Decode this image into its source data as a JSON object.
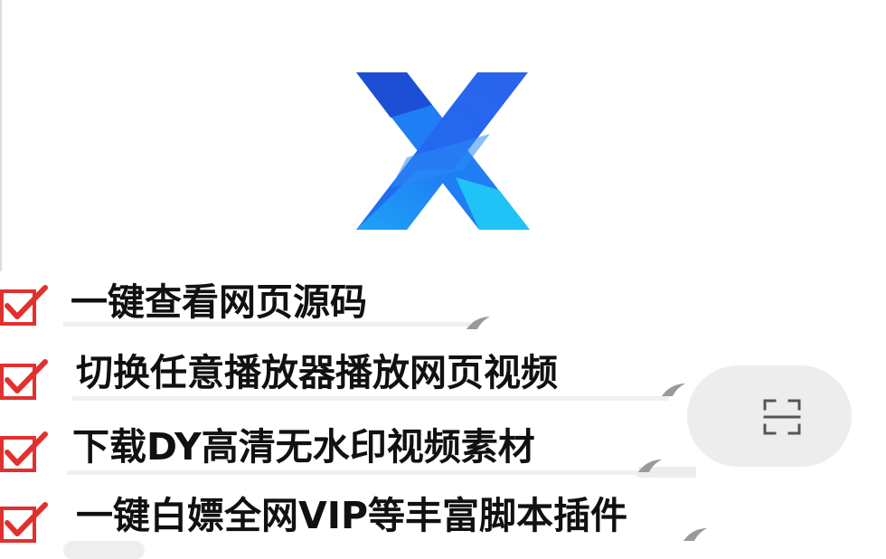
{
  "logo": {
    "icon": "x-browser-logo-icon",
    "colors": {
      "left_top": "#1f4fd6",
      "right_top": "#2a66f0",
      "center": "#1e7cf5",
      "right_bottom": "#1fb7f4"
    }
  },
  "scan_button": {
    "icon": "scan-frame-icon"
  },
  "features": [
    {
      "text": "一键查看网页源码",
      "check_icon": "checkbox-checked-icon"
    },
    {
      "text": "切换任意播放器播放网页视频",
      "check_icon": "checkbox-checked-icon"
    },
    {
      "text": "下载DY高清无水印视频素材",
      "check_icon": "checkbox-checked-icon"
    },
    {
      "text": "一键白嫖全网VIP等丰富脚本插件",
      "check_icon": "checkbox-checked-icon"
    }
  ],
  "colors": {
    "check_red": "#e0312f",
    "text": "#111111",
    "pill_grey": "#ededed"
  }
}
